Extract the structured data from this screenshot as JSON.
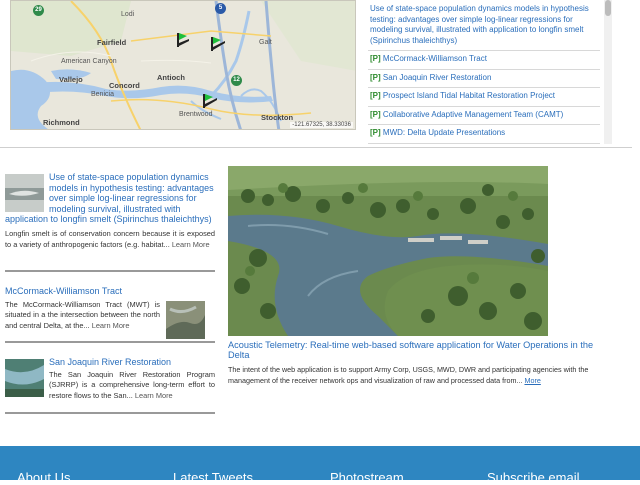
{
  "map": {
    "places": [
      "Fairfield",
      "American Canyon",
      "Vallejo",
      "Concord",
      "Antioch",
      "Richmond",
      "Brentwood",
      "Stockton",
      "Galt",
      "Lodi",
      "Benicia"
    ],
    "highways": [
      "29",
      "5",
      "12"
    ],
    "coordinates": "-121.67325, 38.33036"
  },
  "list": {
    "items": [
      {
        "tag": "",
        "label": "Use of state-space population dynamics models in hypothesis testing: advantages over simple log-linear regressions for modeling survival, illustrated with application to longfin smelt (Spirinchus thaleichthys)"
      },
      {
        "tag": "[P]",
        "label": "McCormack-Williamson Tract"
      },
      {
        "tag": "[P]",
        "label": "San Joaquin River Restoration"
      },
      {
        "tag": "[P]",
        "label": "Prospect Island Tidal Habitat Restoration Project"
      },
      {
        "tag": "[P]",
        "label": "Collaborative Adaptive Management Team (CAMT)"
      },
      {
        "tag": "[P]",
        "label": "MWD: Delta Update Presentations"
      }
    ]
  },
  "features": [
    {
      "title": "Use of state-space population dynamics models in hypothesis testing: advantages over simple log-linear regressions for modeling survival, illustrated with application to longfin smelt (Spirinchus thaleichthys)",
      "body": "Longfin smelt is of conservation concern because it is exposed to a variety of anthropogenic factors (e.g. habitat...",
      "more": "Learn More"
    },
    {
      "title": "McCormack-Williamson Tract",
      "body": "The McCormack-Williamson Tract (MWT) is situated in a the intersection between the north and central Delta, at the...",
      "more": "Learn More"
    },
    {
      "title": "San Joaquin River Restoration",
      "body": "The San Joaquin River Restoration Program (SJRRP) is a comprehensive long-term effort to restore flows to the San...",
      "more": "Learn More"
    }
  ],
  "hero": {
    "title": "Acoustic Telemetry: Real-time web-based software application for Water Operations in the Delta",
    "body": "The intent of the web application is to support Army Corp, USGS, MWD, DWR and participating agencies with the management of the receiver network ops and visualization of raw and processed data from...",
    "more": "More"
  },
  "footer": {
    "columns": [
      "About Us",
      "Latest Tweets",
      "Photostream",
      "Subscribe email"
    ]
  },
  "colors": {
    "link": "#2a6ebb",
    "tag": "#2e8b2e",
    "footer": "#2e86c1"
  }
}
